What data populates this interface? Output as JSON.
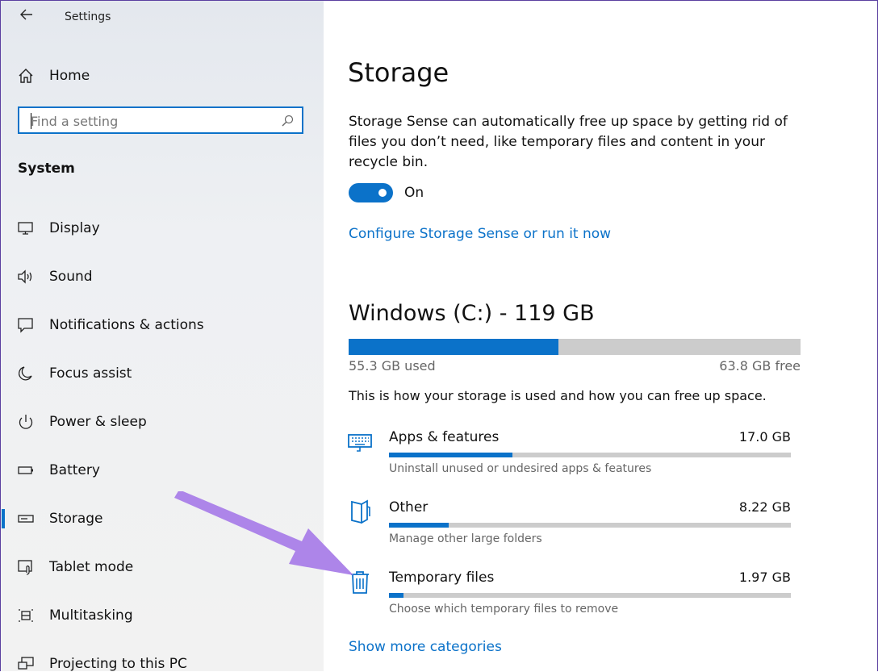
{
  "window": {
    "title": "Settings",
    "back_icon": "back-arrow-icon"
  },
  "sidebar": {
    "home_label": "Home",
    "search_placeholder": "Find a setting",
    "section_title": "System",
    "items": [
      {
        "label": "Display",
        "icon": "display-icon"
      },
      {
        "label": "Sound",
        "icon": "speaker-icon"
      },
      {
        "label": "Notifications & actions",
        "icon": "notification-icon"
      },
      {
        "label": "Focus assist",
        "icon": "moon-icon"
      },
      {
        "label": "Power & sleep",
        "icon": "power-icon"
      },
      {
        "label": "Battery",
        "icon": "battery-icon"
      },
      {
        "label": "Storage",
        "icon": "storage-icon",
        "selected": true
      },
      {
        "label": "Tablet mode",
        "icon": "tablet-mode-icon"
      },
      {
        "label": "Multitasking",
        "icon": "multitasking-icon"
      },
      {
        "label": "Projecting to this PC",
        "icon": "projecting-icon"
      }
    ]
  },
  "main": {
    "title": "Storage",
    "description": "Storage Sense can automatically free up space by getting rid of files you don’t need, like temporary files and content in your recycle bin.",
    "toggle": {
      "state": "On",
      "on": true
    },
    "configure_link": "Configure Storage Sense or run it now",
    "drive": {
      "title": "Windows (C:) - 119 GB",
      "used_label": "55.3 GB used",
      "free_label": "63.8 GB free",
      "used_fraction": 0.464
    },
    "usage_text": "This is how your storage is used and how you can free up space.",
    "categories": [
      {
        "name": "Apps & features",
        "size": "17.0 GB",
        "sub": "Uninstall unused or undesired apps & features",
        "fraction": 0.308,
        "icon": "keyboard-icon"
      },
      {
        "name": "Other",
        "size": "8.22 GB",
        "sub": "Manage other large folders",
        "fraction": 0.149,
        "icon": "folder-icon"
      },
      {
        "name": "Temporary files",
        "size": "1.97 GB",
        "sub": "Choose which temporary files to remove",
        "fraction": 0.036,
        "icon": "trash-icon"
      }
    ],
    "show_more_link": "Show more categories"
  },
  "colors": {
    "accent": "#0b72c9",
    "arrow": "#a97ee8",
    "bar_bg": "#cccccc"
  }
}
